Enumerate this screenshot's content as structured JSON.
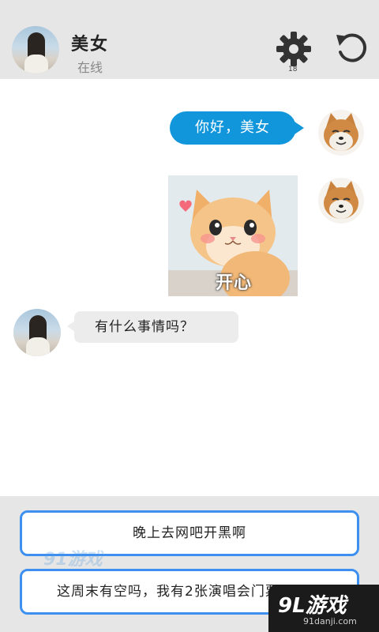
{
  "header": {
    "contact_name": "美女",
    "contact_status": "在线",
    "settings_count": "18"
  },
  "messages": [
    {
      "side": "right",
      "type": "text",
      "text": "你好，美女"
    },
    {
      "side": "right",
      "type": "image",
      "caption": "开心"
    },
    {
      "side": "left",
      "type": "text",
      "text": "有什么事情吗？"
    }
  ],
  "options": [
    {
      "label": "晚上去网吧开黑啊"
    },
    {
      "label": "这周末有空吗，我有2张演唱会门票"
    }
  ],
  "watermark": {
    "center": "91游戏",
    "corner_big": "9L游戏",
    "corner_small": "91danji.com"
  },
  "colors": {
    "header_bg": "#e6e6e6",
    "accent_blue": "#1296db",
    "option_border": "#3d8ff0",
    "incoming_bubble": "#ececec"
  },
  "icons": [
    "gear-icon",
    "reset-icon",
    "heart-icon"
  ]
}
